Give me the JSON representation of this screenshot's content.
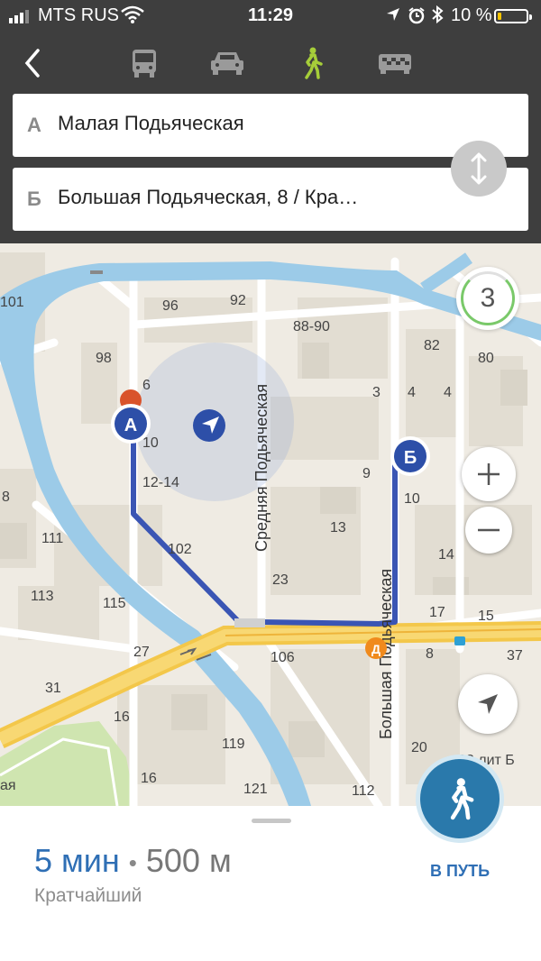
{
  "status": {
    "carrier": "MTS RUS",
    "time": "11:29",
    "battery": "10 %",
    "battery_level": 0.1
  },
  "modes": {
    "back": "back-icon",
    "items": [
      {
        "icon": "bus-icon",
        "active": false
      },
      {
        "icon": "car-icon",
        "active": false
      },
      {
        "icon": "pedestrian-icon",
        "active": true
      },
      {
        "icon": "taxi-icon",
        "active": false
      }
    ],
    "active_color": "#a6ce39"
  },
  "route": {
    "from": {
      "prefix": "А",
      "value": "Малая Подьяческая"
    },
    "to": {
      "prefix": "Б",
      "value": "Большая Подьяческая, 8 / Кра…"
    },
    "swap_icon": "swap-vertical-icon"
  },
  "map": {
    "traffic_level": "3",
    "streets": [
      "Средняя Подьяческая",
      "Большая Подьяческая"
    ],
    "house_numbers": [
      "101",
      "96",
      "92",
      "88-90",
      "82",
      "80",
      "98",
      "6",
      "3",
      "4",
      "4",
      "10",
      "12-14",
      "9",
      "10",
      "8",
      "111",
      "102",
      "13",
      "14",
      "113",
      "115",
      "23",
      "17",
      "15",
      "27",
      "106",
      "8",
      "37",
      "31",
      "16",
      "119",
      "20",
      "16",
      "121",
      "112",
      "32 лит Б",
      "ая"
    ],
    "marker_a": "А",
    "marker_b": "Б",
    "metro": "Д",
    "route_color": "#3a55b4"
  },
  "summary": {
    "duration": "5 мин",
    "separator": "•",
    "distance": "500 м",
    "route_type": "Кратчайший",
    "go_label": "В ПУТЬ"
  }
}
